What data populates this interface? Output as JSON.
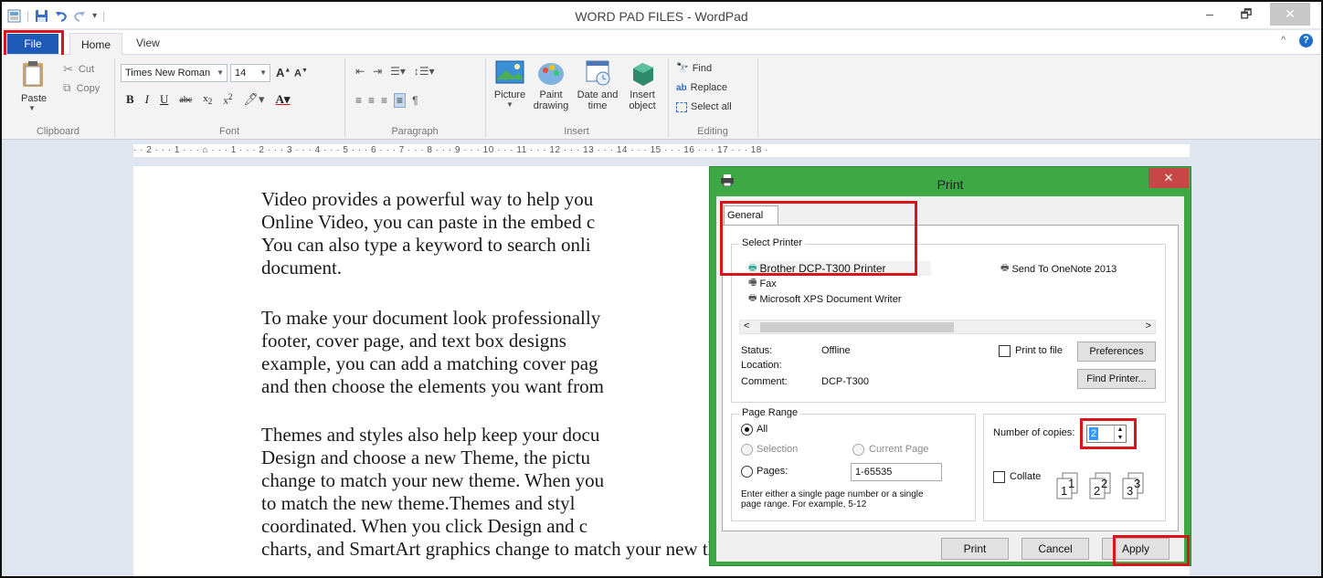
{
  "window": {
    "title": "WORD PAD FILES - WordPad"
  },
  "ribbon": {
    "tabs": {
      "file": "File",
      "home": "Home",
      "view": "View"
    },
    "clipboard": {
      "paste": "Paste",
      "cut": "Cut",
      "copy": "Copy",
      "label": "Clipboard"
    },
    "font": {
      "family": "Times New Roman",
      "size": "14",
      "label": "Font"
    },
    "paragraph": {
      "label": "Paragraph"
    },
    "insert": {
      "picture": "Picture",
      "paint1": "Paint",
      "paint2": "drawing",
      "date1": "Date and",
      "date2": "time",
      "object1": "Insert",
      "object2": "object",
      "label": "Insert"
    },
    "editing": {
      "find": "Find",
      "replace": "Replace",
      "select_all": "Select all",
      "label": "Editing"
    }
  },
  "ruler": {
    "text": "· · 2 · · · 1 · · · ⌂ · · · 1 · · · 2 · · · 3 · · · 4 · · · 5 · · · 6 · · · 7 · · · 8 · · · 9 · · · 10 · · · 11 · · · 12 · · · 13 · · · 14 · · · 15 · · · 16 · · · 17 · · · 18 ·"
  },
  "document": {
    "p1_l1": "Video provides a powerful way to help you",
    "p1_l2": "Online Video, you can paste in the embed c",
    "p1_l3": "You can also type a keyword to search onli",
    "p1_l4": "document.",
    "p2_l1": "To make your document look professionally",
    "p2_l2": "footer, cover page, and text box designs",
    "p2_l3": "example, you can add a matching cover pag",
    "p2_l4": "and then choose the elements you want from",
    "p3_l1": "Themes and styles also help keep your docu",
    "p3_l2": "Design and choose a new Theme, the pictu",
    "p3_l3": "change to match your new theme. When you",
    "p3_l4": "to match the new theme.Themes and styl",
    "p3_l5": "coordinated. When you click Design and c",
    "p3_l6": "charts, and SmartArt graphics change to match your new theme. When you"
  },
  "print_dialog": {
    "title": "Print",
    "tab_general": "General",
    "select_printer_legend": "Select Printer",
    "printers": [
      "Brother DCP-T300 Printer",
      "Fax",
      "Microsoft XPS Document Writer",
      "Send To OneNote 2013"
    ],
    "status_label": "Status:",
    "status_value": "Offline",
    "location_label": "Location:",
    "comment_label": "Comment:",
    "comment_value": "DCP-T300",
    "print_to_file": "Print to file",
    "preferences": "Preferences",
    "find_printer": "Find Printer...",
    "page_range_legend": "Page Range",
    "range_all": "All",
    "range_selection": "Selection",
    "range_current": "Current Page",
    "range_pages": "Pages:",
    "pages_value": "1-65535",
    "pages_hint_1": "Enter either a single page number or a single",
    "pages_hint_2": "page range.  For example, 5-12",
    "copies_label": "Number of copies:",
    "copies_value": "2",
    "collate": "Collate",
    "print_btn": "Print",
    "cancel_btn": "Cancel",
    "apply_btn": "Apply"
  },
  "colors": {
    "file_tab": "#1e5bb8",
    "dialog_frame": "#3da844",
    "highlight": "#d9141b"
  }
}
